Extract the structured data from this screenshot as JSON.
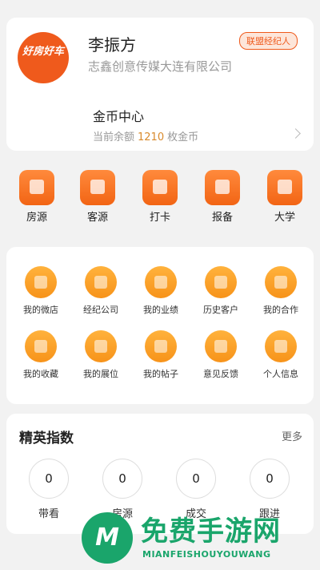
{
  "profile": {
    "avatar_text": "好房好车",
    "name": "李振方",
    "company": "志鑫创意传媒大连有限公司",
    "badge": "联盟经纪人",
    "coin_title": "金币中心",
    "coin_prefix": "当前余额",
    "coin_value": "1210",
    "coin_suffix": "枚金币"
  },
  "quick_nav": [
    {
      "label": "房源",
      "icon": "house-icon"
    },
    {
      "label": "客源",
      "icon": "person-icon"
    },
    {
      "label": "打卡",
      "icon": "checkin-icon"
    },
    {
      "label": "报备",
      "icon": "report-icon"
    },
    {
      "label": "大学",
      "icon": "building-icon"
    }
  ],
  "grid": [
    {
      "label": "我的微店",
      "icon": "shop-icon"
    },
    {
      "label": "经纪公司",
      "icon": "company-icon"
    },
    {
      "label": "我的业绩",
      "icon": "performance-icon"
    },
    {
      "label": "历史客户",
      "icon": "history-icon"
    },
    {
      "label": "我的合作",
      "icon": "cooperation-icon"
    },
    {
      "label": "我的收藏",
      "icon": "folder-icon"
    },
    {
      "label": "我的展位",
      "icon": "booth-icon"
    },
    {
      "label": "我的帖子",
      "icon": "post-icon"
    },
    {
      "label": "意见反馈",
      "icon": "feedback-icon"
    },
    {
      "label": "个人信息",
      "icon": "profile-icon"
    }
  ],
  "elite": {
    "title": "精英指数",
    "more": "更多",
    "stats": [
      {
        "value": "0",
        "label": "带看"
      },
      {
        "value": "0",
        "label": "房源"
      },
      {
        "value": "0",
        "label": "成交"
      },
      {
        "value": "0",
        "label": "跟进"
      }
    ]
  },
  "watermark": {
    "title": "免费手游网",
    "subtitle": "MIANFEISHOUYOUWANG"
  },
  "colors": {
    "accent": "#ef5a1c",
    "grid_icon": "#f7931a",
    "watermark": "#1aa56b"
  }
}
